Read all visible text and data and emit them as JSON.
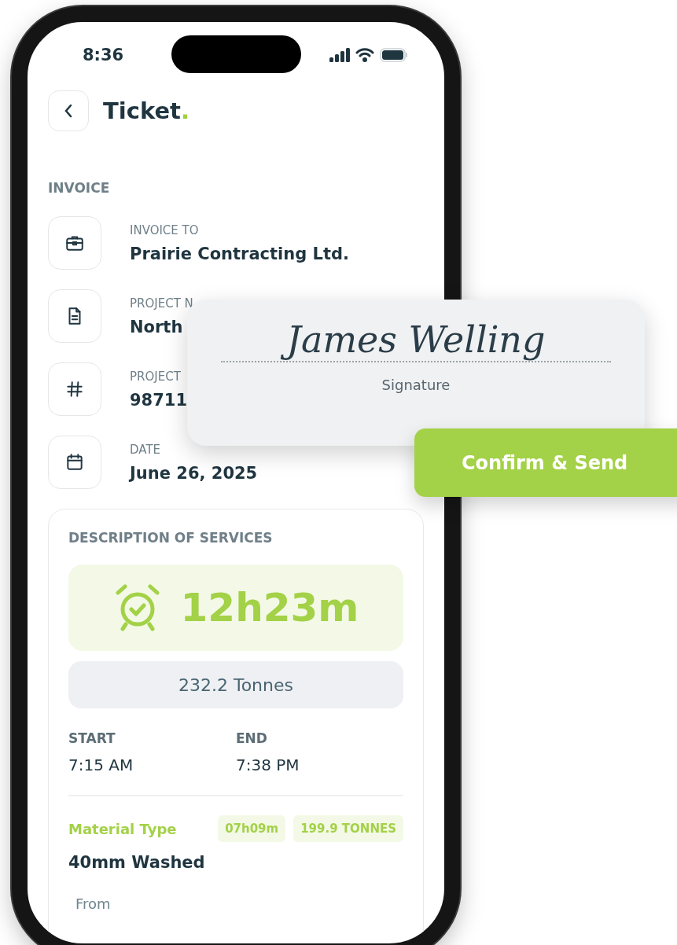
{
  "status_bar": {
    "time": "8:36"
  },
  "header": {
    "title": "Ticket",
    "title_accent": "."
  },
  "invoice": {
    "heading": "INVOICE",
    "fields": [
      {
        "kind": "briefcase",
        "label": "INVOICE TO",
        "value": "Prairie Contracting Ltd."
      },
      {
        "kind": "document",
        "label": "PROJECT N",
        "value": "North"
      },
      {
        "kind": "hash",
        "label": "PROJECT",
        "value": "98711"
      },
      {
        "kind": "calendar",
        "label": "DATE",
        "value": "June 26, 2025"
      }
    ]
  },
  "services": {
    "heading": "DESCRIPTION OF SERVICES",
    "duration": "12h23m",
    "weight": "232.2 Tonnes",
    "times": [
      {
        "label": "START",
        "value": "7:15 AM"
      },
      {
        "label": "END",
        "value": "7:38 PM"
      }
    ],
    "material": {
      "label": "Material Type",
      "chips": [
        "07h09m",
        "199.9 TONNES"
      ],
      "value": "40mm Washed"
    },
    "from_label": "From"
  },
  "signature_card": {
    "signature": "James Welling",
    "caption": "Signature"
  },
  "confirm_button": "Confirm & Send"
}
